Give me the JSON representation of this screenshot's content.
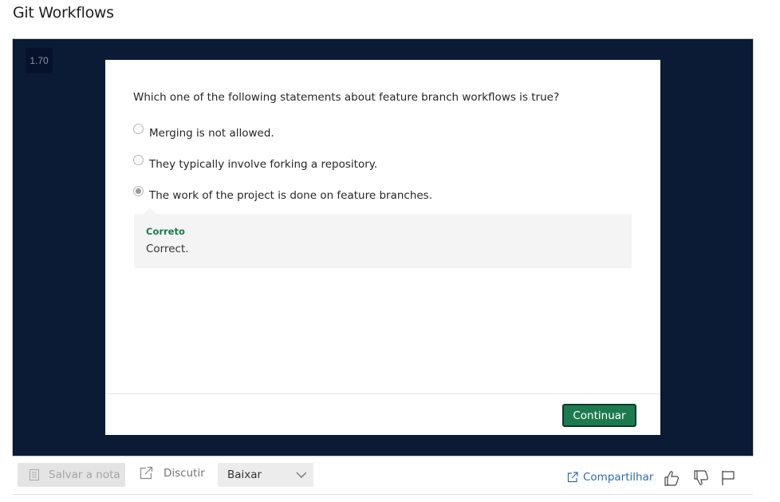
{
  "page": {
    "title": "Git Workflows"
  },
  "player": {
    "speed": "1.70"
  },
  "quiz": {
    "question": "Which one of the following statements about feature branch workflows is true?",
    "options": [
      {
        "label": "Merging is not allowed.",
        "selected": false
      },
      {
        "label": "They typically involve forking a repository.",
        "selected": false
      },
      {
        "label": "The work of the project is done on feature branches.",
        "selected": true
      }
    ],
    "feedback": {
      "title": "Correto",
      "text": "Correct."
    },
    "continue_label": "Continuar"
  },
  "toolbar": {
    "save_note": "Salvar a nota",
    "discuss": "Discutir",
    "download": "Baixar",
    "share": "Compartilhar"
  },
  "colors": {
    "player_bg": "#0b1a35",
    "accent_green": "#1d7a4f",
    "link_blue": "#2f6ea8"
  }
}
